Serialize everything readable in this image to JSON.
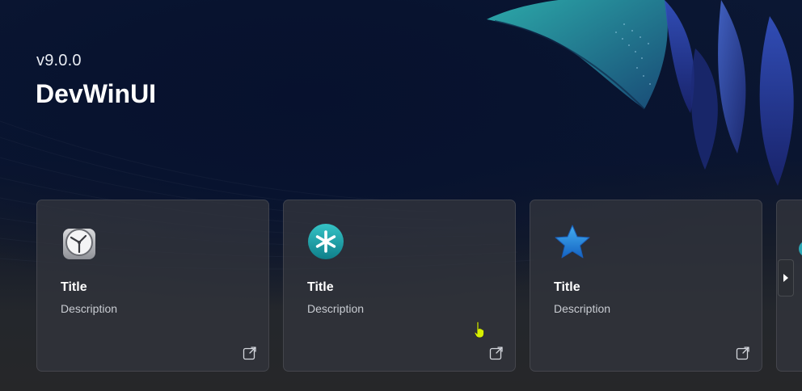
{
  "header": {
    "version": "v9.0.0",
    "app_title": "DevWinUI"
  },
  "cards": [
    {
      "title": "Title",
      "description": "Description",
      "icon": "clock-icon",
      "link_icon": "open-external-icon"
    },
    {
      "title": "Title",
      "description": "Description",
      "icon": "asterisk-icon",
      "link_icon": "open-external-icon"
    },
    {
      "title": "Title",
      "description": "Description",
      "icon": "star-icon",
      "link_icon": "open-external-icon"
    }
  ],
  "scroller": {
    "next_icon": "chevron-right-icon"
  },
  "colors": {
    "hero_bg": "#0a1530",
    "card_bg": "#32353c",
    "accent_teal": "#1aa3a8",
    "star_blue": "#1e7fd8",
    "cursor_yellow": "#d7f000"
  }
}
